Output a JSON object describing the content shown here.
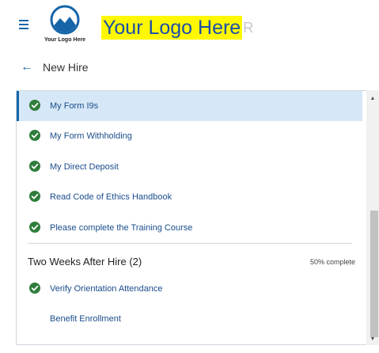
{
  "header": {
    "menu_icon": "hamburger-menu-icon",
    "logo_caption": "Your Logo Here",
    "logo_banner_text": "Your Logo Here",
    "logo_banner_tail": "R",
    "colors": {
      "accent": "#1565a8",
      "banner_bg": "#fff800",
      "banner_text": "#1a4ea8"
    }
  },
  "subheader": {
    "back_icon": "back-arrow-icon",
    "back_arrow_glyph": "←",
    "title": "New Hire"
  },
  "tasks": [
    {
      "label": "My Form I9s",
      "completed": true,
      "selected": true
    },
    {
      "label": "My Form Withholding",
      "completed": true,
      "selected": false
    },
    {
      "label": "My Direct Deposit",
      "completed": true,
      "selected": false
    },
    {
      "label": "Read Code of Ethics Handbook",
      "completed": true,
      "selected": false
    },
    {
      "label": "Please complete the Training Course",
      "completed": true,
      "selected": false
    }
  ],
  "group": {
    "title": "Two Weeks After Hire (2)",
    "progress": "50% complete",
    "tasks": [
      {
        "label": "Verify Orientation Attendance",
        "completed": true
      },
      {
        "label": "Benefit Enrollment",
        "completed": false
      }
    ]
  },
  "status_colors": {
    "complete_check": "#2f7d3c",
    "selected_row": "#d6e8f7",
    "task_link": "#1a4d8c"
  },
  "scrollbar": {
    "up_glyph": "▲",
    "down_glyph": "▼"
  }
}
